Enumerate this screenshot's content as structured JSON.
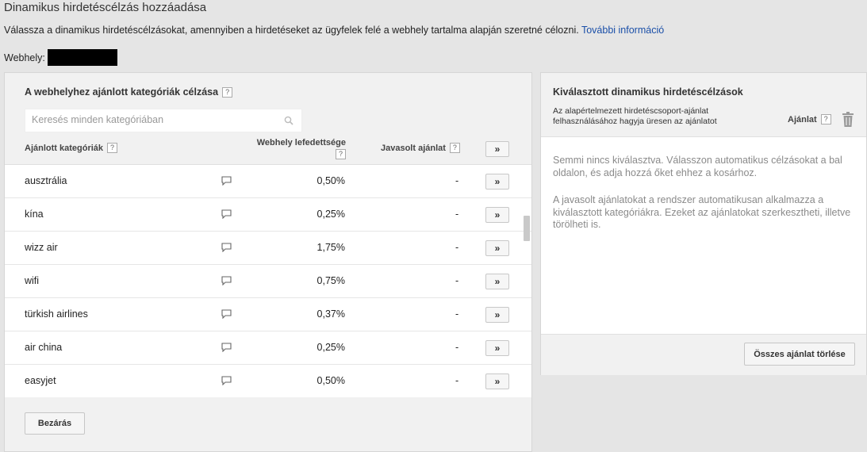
{
  "page": {
    "title": "Dinamikus hirdetéscélzás hozzáadása",
    "intro": "Válassza a dinamikus hirdetéscélzásokat, amennyiben a hirdetéseket az ügyfelek felé a webhely tartalma alapján szeretné célozni.",
    "more_info_link": "További információ",
    "website_label": "Webhely:"
  },
  "left_panel": {
    "title": "A webhelyhez ajánlott kategóriák célzása",
    "search_placeholder": "Keresés minden kategóriában",
    "columns": {
      "category": "Ajánlott kategóriák",
      "coverage": "Webhely lefedettsége",
      "suggested_bid": "Javasolt ajánlat"
    },
    "add_all_label": "»",
    "rows": [
      {
        "name": "ausztrália",
        "coverage": "0,50%",
        "bid": "-",
        "add": "»"
      },
      {
        "name": "kína",
        "coverage": "0,25%",
        "bid": "-",
        "add": "»"
      },
      {
        "name": "wizz air",
        "coverage": "1,75%",
        "bid": "-",
        "add": "»"
      },
      {
        "name": "wifi",
        "coverage": "0,75%",
        "bid": "-",
        "add": "»"
      },
      {
        "name": "türkish airlines",
        "coverage": "0,37%",
        "bid": "-",
        "add": "»"
      },
      {
        "name": "air china",
        "coverage": "0,25%",
        "bid": "-",
        "add": "»"
      },
      {
        "name": "easyjet",
        "coverage": "0,50%",
        "bid": "-",
        "add": "»"
      }
    ],
    "close_button": "Bezárás"
  },
  "right_panel": {
    "title": "Kiválasztott dinamikus hirdetéscélzások",
    "hint": "Az alapértelmezett hirdetéscsoport-ajánlat felhasználásához hagyja üresen az ajánlatot",
    "bid_label": "Ajánlat",
    "empty_text_1": "Semmi nincs kiválasztva. Válasszon automatikus célzásokat a bal oldalon, és adja hozzá őket ehhez a kosárhoz.",
    "empty_text_2": "A javasolt ajánlatokat a rendszer automatikusan alkalmazza a kiválasztott kategóriákra. Ezeket az ajánlatokat szerkesztheti, illetve törölheti is.",
    "clear_button": "Összes ajánlat törlése"
  },
  "help_glyph": "?"
}
